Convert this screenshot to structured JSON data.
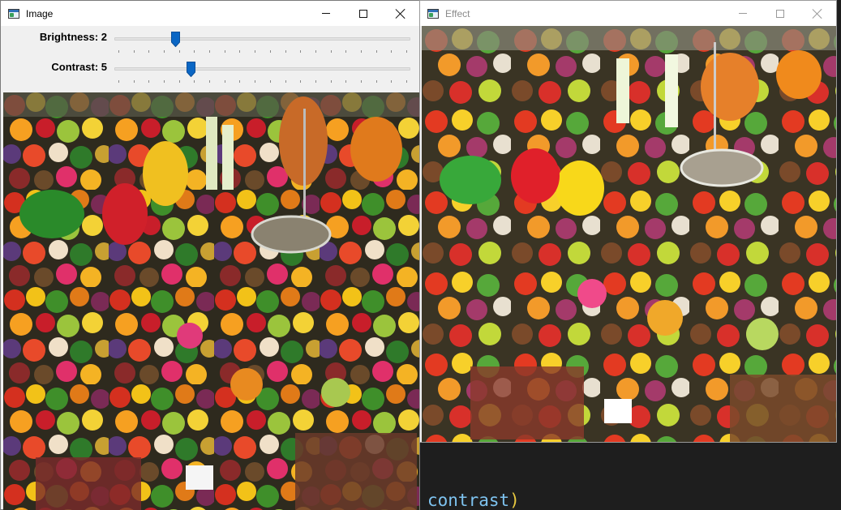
{
  "image_window": {
    "title": "Image",
    "trackbars": [
      {
        "label": "Brightness: 2",
        "value": 2,
        "max": 10
      },
      {
        "label": "Contrast: 5",
        "value": 5,
        "max": 20
      }
    ]
  },
  "effect_window": {
    "title": "Effect"
  },
  "editor": {
    "identifier": "contrast",
    "closing_paren": ")"
  },
  "colors": {
    "accent": "#0a66c4",
    "editor_bg": "#1e1e1e",
    "identifier": "#7ec3f0",
    "paren": "#e8c840"
  },
  "icons": [
    "app-icon",
    "minimize-icon",
    "maximize-icon",
    "close-icon",
    "slider-thumb-icon"
  ]
}
